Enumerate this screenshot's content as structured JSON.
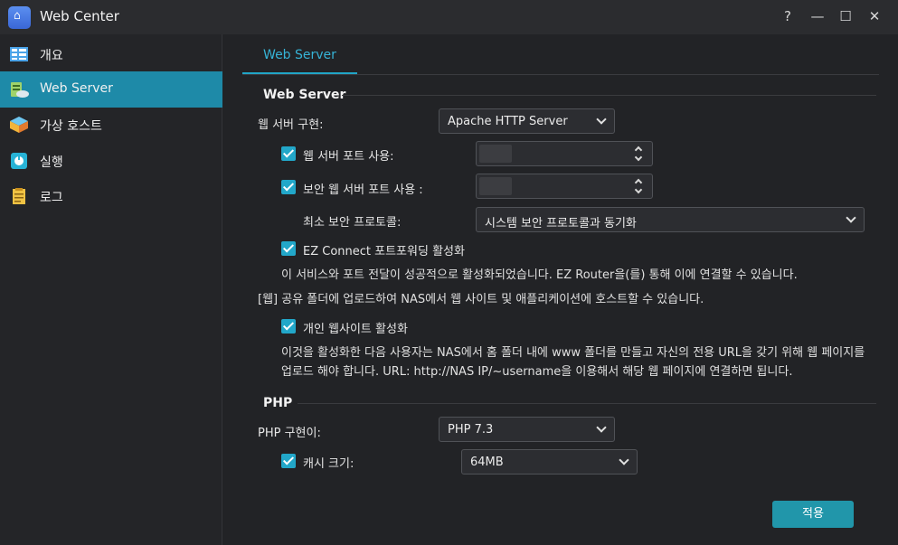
{
  "window": {
    "title": "Web Center"
  },
  "controls": {
    "help": "?",
    "minimize": "—",
    "maximize": "☐",
    "close": "✕"
  },
  "sidebar": {
    "items": [
      {
        "label": "개요",
        "icon": "overview-icon"
      },
      {
        "label": "Web Server",
        "icon": "web-server-icon",
        "active": true
      },
      {
        "label": "가상 호스트",
        "icon": "virtual-host-icon"
      },
      {
        "label": "실행",
        "icon": "execute-icon"
      },
      {
        "label": "로그",
        "icon": "log-icon"
      }
    ]
  },
  "tabs": [
    {
      "label": "Web Server"
    }
  ],
  "web_server": {
    "section_title": "Web Server",
    "impl_label": "웹 서버 구현:",
    "impl_value": "Apache HTTP Server",
    "port_label": "웹 서버 포트 사용:",
    "secure_port_label": "보안 웹 서버 포트 사용 :",
    "min_protocol_label": "최소 보안 프로토콜:",
    "min_protocol_value": "시스템 보안 프로토콜과 동기화",
    "ez_connect_label": "EZ Connect 포트포워딩 활성화",
    "ez_connect_note": "이 서비스와 포트 전달이 성공적으로 활성화되었습니다. EZ Router을(를) 통해 이에 연결할 수 있습니다.",
    "share_note": "[웹] 공유 폴더에 업로드하여 NAS에서 웹 사이트 및 애플리케이션에 호스트할 수 있습니다.",
    "personal_site_label": "개인 웹사이트 활성화",
    "personal_site_note": "이것을 활성화한 다음 사용자는 NAS에서 홈 폴더 내에 www 폴더를 만들고 자신의 전용 URL을 갖기 위해 웹 페이지를 업로드 해야 합니다. URL: http://NAS IP/~username을 이용해서 해당 웹 페이지에 연결하면 됩니다."
  },
  "php": {
    "section_title": "PHP",
    "impl_label": "PHP 구현이:",
    "impl_value": "PHP 7.3",
    "cache_label": "캐시 크기:",
    "cache_value": "64MB"
  },
  "apply_label": "적용",
  "colors": {
    "accent": "#22a7c9",
    "active_nav": "#1e8aa8",
    "button": "#2196aa"
  }
}
